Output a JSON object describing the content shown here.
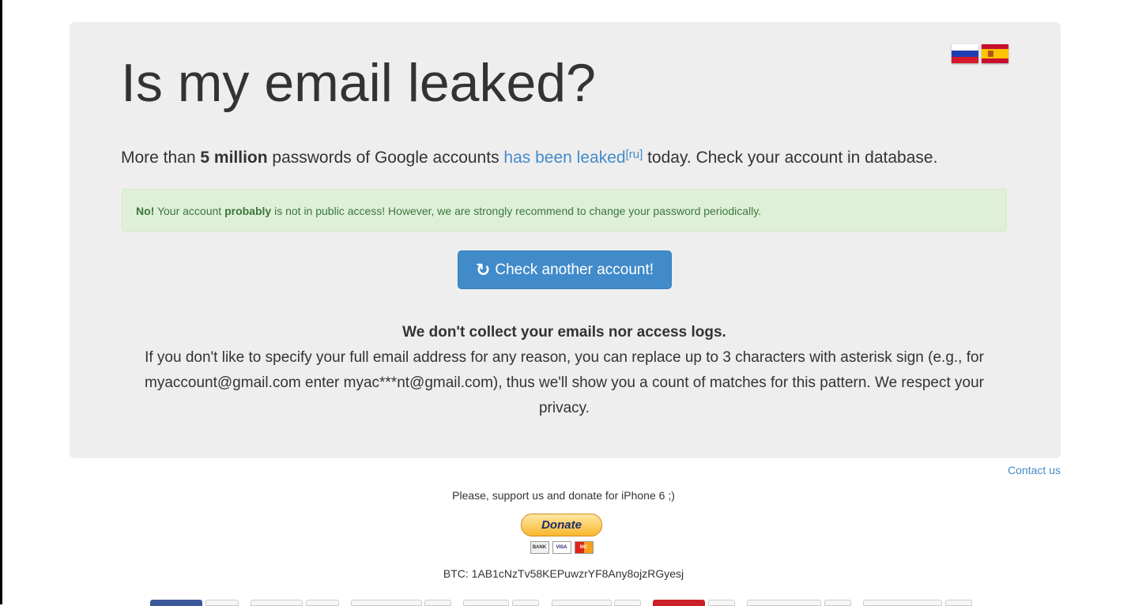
{
  "header": {
    "title": "Is my email leaked?",
    "lead_prefix": "More than ",
    "lead_bold": "5 million",
    "lead_middle": " passwords of Google accounts ",
    "lead_link": "has been leaked",
    "lead_sup": "[ru]",
    "lead_suffix": " today. Check your account in database."
  },
  "languages": [
    {
      "name": "ru",
      "icon": "russia-flag-icon"
    },
    {
      "name": "es",
      "icon": "spain-flag-icon"
    }
  ],
  "alert": {
    "strong": "No!",
    "part1": " Your account ",
    "bold": "probably",
    "part2": " is not in public access! However, we are strongly recommend to change your password periodically."
  },
  "check_button": {
    "icon": "refresh-icon",
    "label": "Check another account!"
  },
  "privacy": {
    "heading": "We don't collect your emails nor access logs.",
    "body": "If you don't like to specify your full email address for any reason, you can replace up to 3 characters with asterisk sign (e.g., for myaccount@gmail.com enter myac***nt@gmail.com), thus we'll show you a count of matches for this pattern. We respect your privacy."
  },
  "footer": {
    "contact": "Contact us",
    "support": "Please, support us and donate for iPhone 6 ;)",
    "donate_label": "Donate",
    "cards": [
      "BANK",
      "VISA",
      "MC"
    ],
    "btc": "BTC: 1AB1cNzTv58KEPuwzrYF8Any8ojzRGyesj"
  },
  "colors": {
    "link": "#428bca",
    "button": "#428bca",
    "alert_bg": "#dff0d8",
    "alert_text": "#3c763d",
    "jumbotron_bg": "#eeeeee"
  }
}
